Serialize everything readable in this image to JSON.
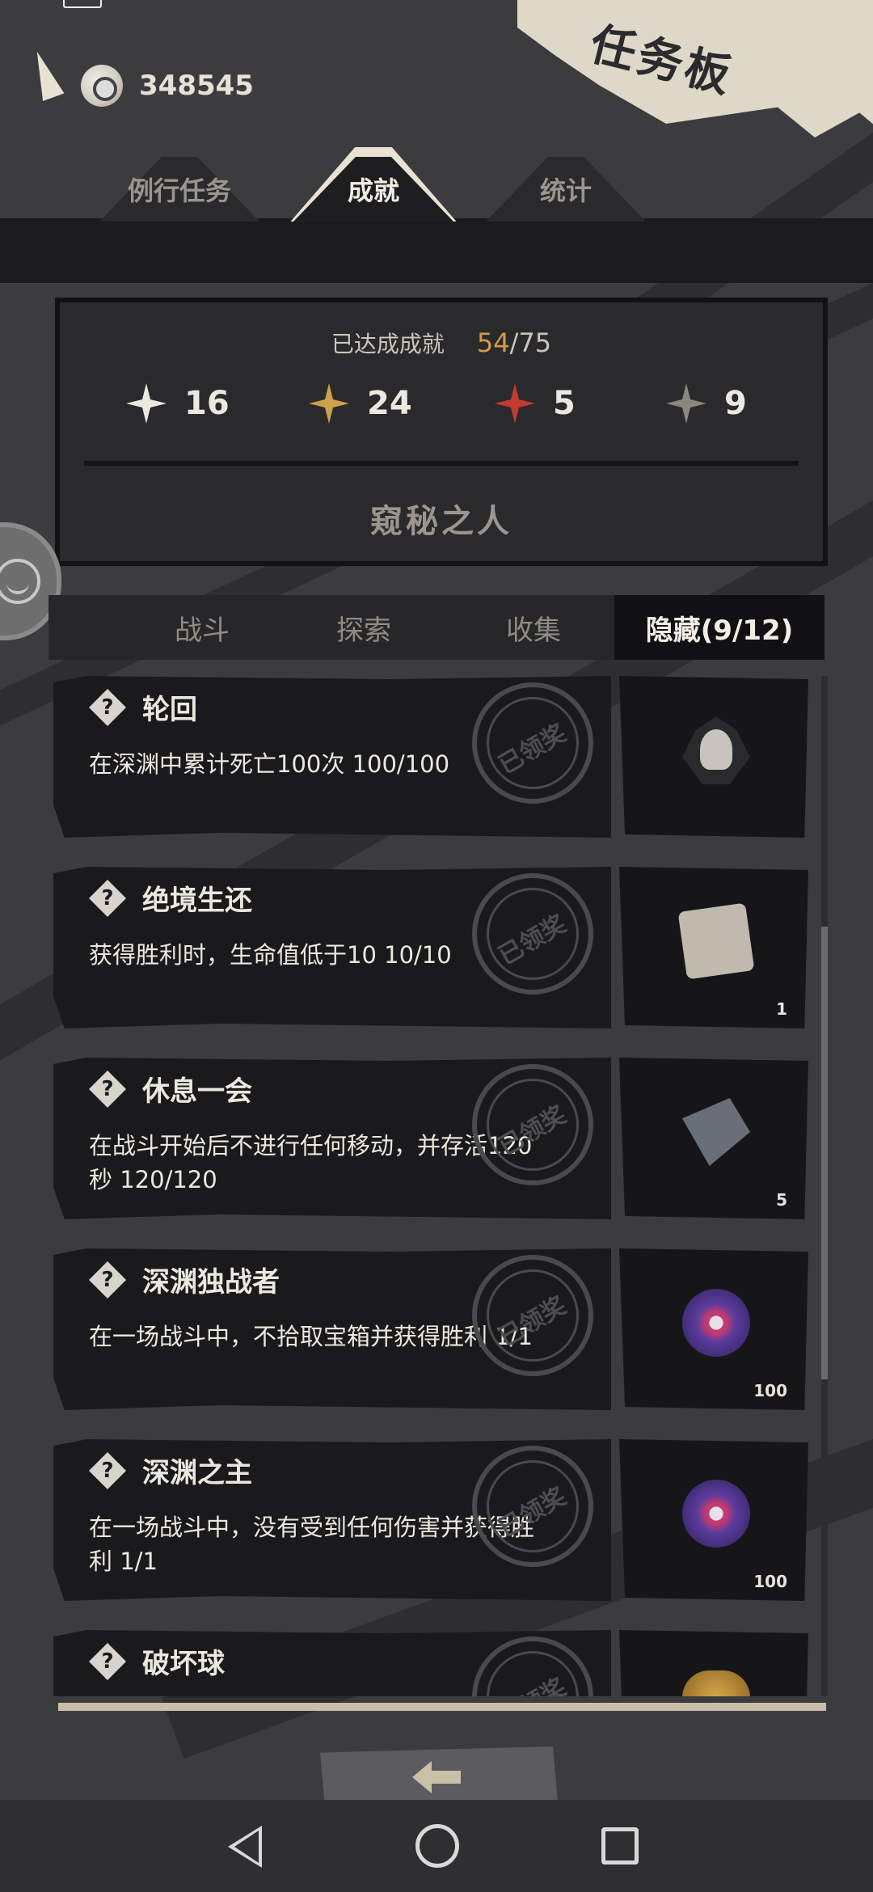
{
  "currency": {
    "value": "348545",
    "icon": "coin-icon"
  },
  "title": "任务板",
  "main_tabs": [
    {
      "label": "例行任务",
      "active": false
    },
    {
      "label": "成就",
      "active": true
    },
    {
      "label": "统计",
      "active": false
    }
  ],
  "summary": {
    "label": "已达成成就",
    "achieved": "54",
    "total": "/75",
    "stars": [
      {
        "type": "white",
        "count": "16"
      },
      {
        "type": "gold",
        "count": "24"
      },
      {
        "type": "red",
        "count": "5"
      },
      {
        "type": "hidden",
        "count": "9"
      }
    ],
    "rank_name": "窥秘之人"
  },
  "category_tabs": [
    {
      "label": "战斗",
      "active": false
    },
    {
      "label": "探索",
      "active": false
    },
    {
      "label": "收集",
      "active": false
    },
    {
      "label": "隐藏(9/12)",
      "active": true
    }
  ],
  "achievements": [
    {
      "title": "轮回",
      "desc": "在深渊中累计死亡100次 100/100",
      "stamp": "已领奖",
      "reward_icon": "skull-emblem-icon",
      "reward_count": ""
    },
    {
      "title": "绝境生还",
      "desc": "获得胜利时，生命值低于10 10/10",
      "stamp": "已领奖",
      "reward_icon": "gadget-box-icon",
      "reward_count": "1"
    },
    {
      "title": "休息一会",
      "desc": "在战斗开始后不进行任何移动，并存活120秒 120/120",
      "stamp": "已领奖",
      "reward_icon": "paper-scrap-icon",
      "reward_count": "5"
    },
    {
      "title": "深渊独战者",
      "desc": "在一场战斗中，不拾取宝箱并获得胜利 1/1",
      "stamp": "已领奖",
      "reward_icon": "eye-orb-icon",
      "reward_count": "100"
    },
    {
      "title": "深渊之主",
      "desc": "在一场战斗中，没有受到任何伤害并获得胜利 1/1",
      "stamp": "已领奖",
      "reward_icon": "eye-orb-icon",
      "reward_count": "100"
    },
    {
      "title": "破坏球",
      "desc": "",
      "stamp": "已领奖",
      "reward_icon": "gold-pile-icon",
      "reward_count": ""
    }
  ],
  "hidden_icon_glyph": "?"
}
